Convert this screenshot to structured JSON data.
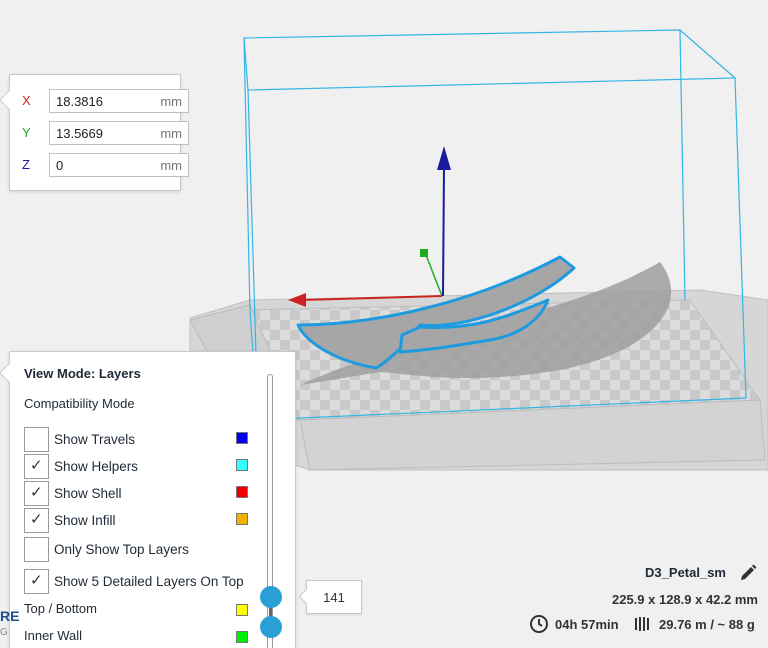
{
  "transform": {
    "x_label": "X",
    "x_value": "18.3816",
    "x_unit": "mm",
    "y_label": "Y",
    "y_value": "13.5669",
    "y_unit": "mm",
    "z_label": "Z",
    "z_value": "0",
    "z_unit": "mm"
  },
  "view": {
    "title": "View Mode: Layers",
    "compat": "Compatibility Mode",
    "options": [
      {
        "label": "Show Travels",
        "checked": false,
        "color": "#0000ee"
      },
      {
        "label": "Show Helpers",
        "checked": true,
        "color": "#33ffff"
      },
      {
        "label": "Show Shell",
        "checked": true,
        "color": "#ee0000"
      },
      {
        "label": "Show Infill",
        "checked": true,
        "color": "#f2b300"
      },
      {
        "label": "Only Show Top Layers",
        "checked": false
      },
      {
        "label": "Show 5 Detailed Layers On Top",
        "checked": true
      }
    ],
    "legend": [
      {
        "label": "Top / Bottom",
        "color": "#ffff00"
      },
      {
        "label": "Inner Wall",
        "color": "#00ee00"
      }
    ],
    "check_glyph": "✓"
  },
  "layer": {
    "current": "141"
  },
  "object": {
    "name": "D3_Petal_sm",
    "dims": "225.9 x 128.9 x 42.2 mm",
    "print_time": "04h 57min",
    "material": "29.76 m / ~ 88 g"
  },
  "logo": {
    "line1": "RE",
    "line2": "G"
  },
  "icons": {
    "edit": "pencil-icon",
    "time": "clock-icon",
    "material": "spool-icon"
  },
  "colors": {
    "accent": "#2a9fd6",
    "x_axis": "#cc2222",
    "y_axis": "#22aa22",
    "z_axis": "#1a1a9c",
    "build_volume": "#33b5e5"
  }
}
